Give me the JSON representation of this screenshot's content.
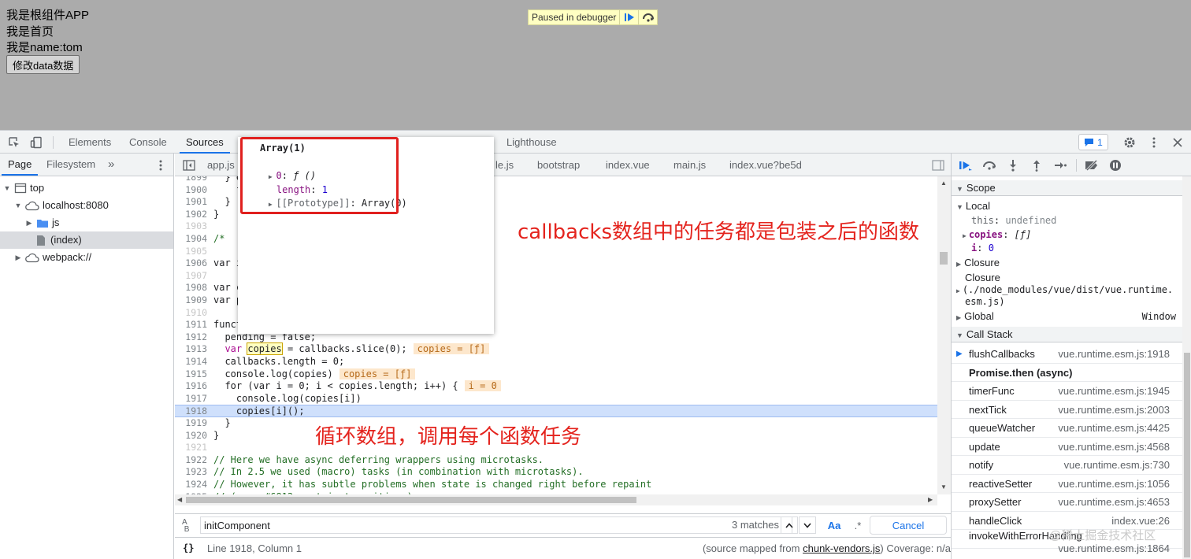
{
  "app": {
    "line1": "我是根组件APP",
    "line2": "我是首页",
    "line3": "我是name:tom",
    "button": "修改data数据"
  },
  "paused_banner": {
    "label": "Paused in debugger",
    "resume_icon": "resume-icon",
    "step_over_icon": "step-over-icon"
  },
  "panel_tabs": [
    "Elements",
    "Console",
    "Sources",
    "Lighthouse"
  ],
  "issues": {
    "count": "1"
  },
  "navigator": {
    "tabs": [
      "Page",
      "Filesystem"
    ],
    "more": "»",
    "tree": [
      {
        "label": "top"
      },
      {
        "label": "localhost:8080"
      },
      {
        "label": "js"
      },
      {
        "label": "(index)"
      },
      {
        "label": "webpack://"
      }
    ]
  },
  "file_tabs": [
    "app.js",
    "le.js",
    "bootstrap",
    "index.vue",
    "main.js",
    "index.vue?be5d"
  ],
  "code_lines": [
    {
      "n": "1899",
      "t": "  } e"
    },
    {
      "n": "1900",
      "t": "    f"
    },
    {
      "n": "1901",
      "t": "  }"
    },
    {
      "n": "1902",
      "t": "}"
    },
    {
      "n": "1903",
      "t": ""
    },
    {
      "n": "1904",
      "t": "/*  '"
    },
    {
      "n": "1905",
      "t": ""
    },
    {
      "n": "1906",
      "t": "var i"
    },
    {
      "n": "1907",
      "t": ""
    },
    {
      "n": "1908",
      "t": "var c"
    },
    {
      "n": "1909",
      "t": "var p"
    },
    {
      "n": "1910",
      "t": ""
    },
    {
      "n": "1911",
      "t": "funct"
    },
    {
      "n": "1912",
      "t": "  pending = false;"
    },
    {
      "n": "1913",
      "t": ""
    },
    {
      "n": "1914",
      "t": "  callbacks.length = 0;"
    },
    {
      "n": "1915",
      "t": "  console.log(copies)"
    },
    {
      "n": "1916",
      "t": ""
    },
    {
      "n": "1917",
      "t": "    console.log(copies[i])"
    },
    {
      "n": "1918",
      "t": "    copies[i]();"
    },
    {
      "n": "1919",
      "t": "  }"
    },
    {
      "n": "1920",
      "t": "}"
    },
    {
      "n": "1921",
      "t": ""
    },
    {
      "n": "1922",
      "t": "// Here we have async deferring wrappers using microtasks."
    },
    {
      "n": "1923",
      "t": "// In 2.5 we used (macro) tasks (in combination with microtasks)."
    },
    {
      "n": "1924",
      "t": "// However, it has subtle problems when state is changed right before repaint"
    },
    {
      "n": "1925",
      "t": "// (e.g. #6813, out-in transitions)."
    }
  ],
  "code_special": {
    "l1913_a": "  var ",
    "l1913_box": "copies",
    "l1913_b": " = callbacks.slice(0);",
    "l1913_inline": "copies = [ƒ]",
    "l1915_inline": "copies = [ƒ]",
    "l1916_a": "  for (var i = 0; i < copies.length; i++) {",
    "l1916_inline": "i = 0"
  },
  "popover": {
    "title": "Array(1)",
    "items": [
      {
        "key": "0",
        "value": "ƒ ()"
      },
      {
        "key": "length",
        "value": "1"
      },
      {
        "key": "[[Prototype]]",
        "value": "Array(0)"
      }
    ]
  },
  "annotations": {
    "top": "callbacks数组中的任务都是包装之后的函数",
    "bottom": "循环数组，调用每个函数任务"
  },
  "search": {
    "value": "initComponent",
    "matches": "3 matches",
    "case_label": "Aa",
    "regex_label": ".*",
    "cancel": "Cancel"
  },
  "status": {
    "braces": "{}",
    "position": "Line 1918, Column 1",
    "mapped_prefix": "(source mapped from ",
    "mapped_link": "chunk-vendors.js",
    "mapped_suffix": ") Coverage: n/a"
  },
  "scope": {
    "title": "Scope",
    "local": "Local",
    "this_name": "this",
    "this_val": "undefined",
    "copies_name": "copies",
    "copies_val": "[ƒ]",
    "i_name": "i",
    "i_val": "0",
    "closure1": "Closure",
    "closure2": "Closure",
    "closure2_path": "(./node_modules/vue/dist/vue.runtime.",
    "closure2_path2": "esm.js)",
    "global": "Global",
    "global_val": "Window"
  },
  "call_stack": {
    "title": "Call Stack",
    "async_label": "Promise.then (async)",
    "frames": [
      {
        "fn": "flushCallbacks",
        "loc": "vue.runtime.esm.js:1918"
      },
      {
        "fn": "timerFunc",
        "loc": "vue.runtime.esm.js:1945"
      },
      {
        "fn": "nextTick",
        "loc": "vue.runtime.esm.js:2003"
      },
      {
        "fn": "queueWatcher",
        "loc": "vue.runtime.esm.js:4425"
      },
      {
        "fn": "update",
        "loc": "vue.runtime.esm.js:4568"
      },
      {
        "fn": "notify",
        "loc": "vue.runtime.esm.js:730"
      },
      {
        "fn": "reactiveSetter",
        "loc": "vue.runtime.esm.js:1056"
      },
      {
        "fn": "proxySetter",
        "loc": "vue.runtime.esm.js:4653"
      },
      {
        "fn": "handleClick",
        "loc": "index.vue:26"
      },
      {
        "fn": "invokeWithErrorHandling",
        "loc": "vue.runtime.esm.js:1864"
      }
    ]
  },
  "watermark": "@稀土掘金技术社区",
  "colors": {
    "accent": "#1a73e8",
    "annotation": "#e4241e",
    "page_overlay": "#ababab"
  }
}
